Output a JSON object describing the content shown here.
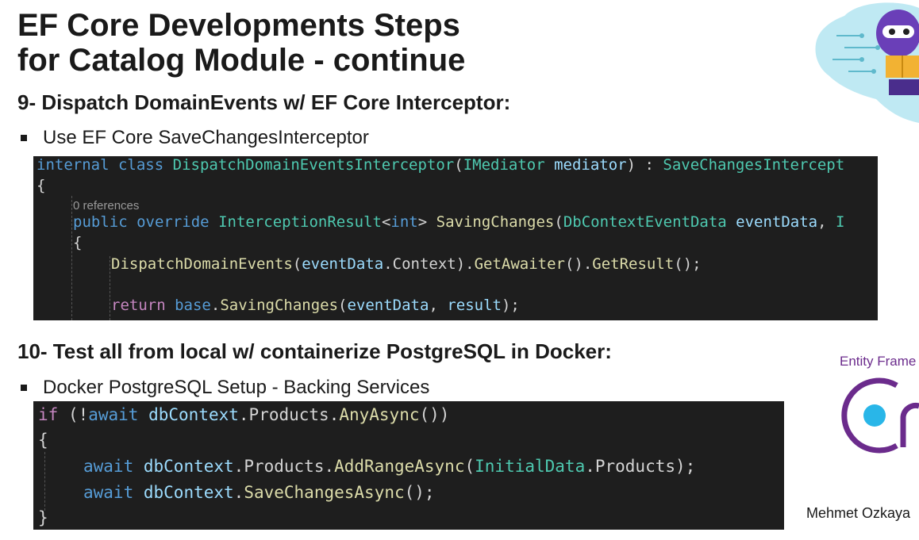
{
  "slide": {
    "title_line1": "EF Core Developments Steps",
    "title_line2": "for Catalog Module - continue",
    "step9": {
      "heading": "9- Dispatch DomainEvents w/ EF Core Interceptor:",
      "bullet": "Use EF Core SaveChangesInterceptor",
      "code": {
        "l1_kw1": "internal",
        "l1_kw2": "class",
        "l1_type": "DispatchDomainEventsInterceptor",
        "l1_p1": "(",
        "l1_type2": "IMediator",
        "l1_param": "mediator",
        "l1_p2": ") : ",
        "l1_type3": "SaveChangesIntercept",
        "l2": "{",
        "refs": "0 references",
        "l3_kw1": "public",
        "l3_kw2": "override",
        "l3_type": "InterceptionResult",
        "l3_lt": "<",
        "l3_int": "int",
        "l3_gt": "> ",
        "l3_fn": "SavingChanges",
        "l3_p1": "(",
        "l3_type2": "DbContextEventData",
        "l3_param": "eventData",
        "l3_p2": ", ",
        "l3_trunc": "I",
        "l4": "{",
        "l5_fn": "DispatchDomainEvents",
        "l5_p1": "(",
        "l5_param": "eventData",
        "l5_p2": ".Context).",
        "l5_fn2": "GetAwaiter",
        "l5_p3": "().",
        "l5_fn3": "GetResult",
        "l5_p4": "();",
        "l6_kw": "return",
        "l6_kw2": "base",
        "l6_p1": ".",
        "l6_fn": "SavingChanges",
        "l6_p2": "(",
        "l6_param": "eventData",
        "l6_p3": ", ",
        "l6_param2": "result",
        "l6_p4": ");"
      }
    },
    "step10": {
      "heading": "10- Test all from local w/ containerize PostgreSQL in Docker:",
      "bullet": "Docker PostgreSQL Setup - Backing Services",
      "code": {
        "l1_kw": "if",
        "l1_p1": " (!",
        "l1_kw2": "await",
        "l1_param": "dbContext",
        "l1_p2": ".Products.",
        "l1_fn": "AnyAsync",
        "l1_p3": "())",
        "l2": "{",
        "l3_kw": "await",
        "l3_param": "dbContext",
        "l3_p1": ".Products.",
        "l3_fn": "AddRangeAsync",
        "l3_p2": "(",
        "l3_type": "InitialData",
        "l3_p3": ".Products);",
        "l4_kw": "await",
        "l4_param": "dbContext",
        "l4_p1": ".",
        "l4_fn": "SaveChangesAsync",
        "l4_p2": "();",
        "l5": "}"
      }
    },
    "ef_label": "Entity Frame",
    "author": "Mehmet Ozkaya",
    "colors": {
      "code_bg": "#1e1e1e",
      "keyword": "#569cd6",
      "control": "#c586c0",
      "type": "#4ec9b0",
      "function": "#dcdcaa",
      "parameter": "#9cdcfe",
      "ef_purple": "#6b2b8c",
      "ef_cyan": "#29b6e8"
    }
  }
}
